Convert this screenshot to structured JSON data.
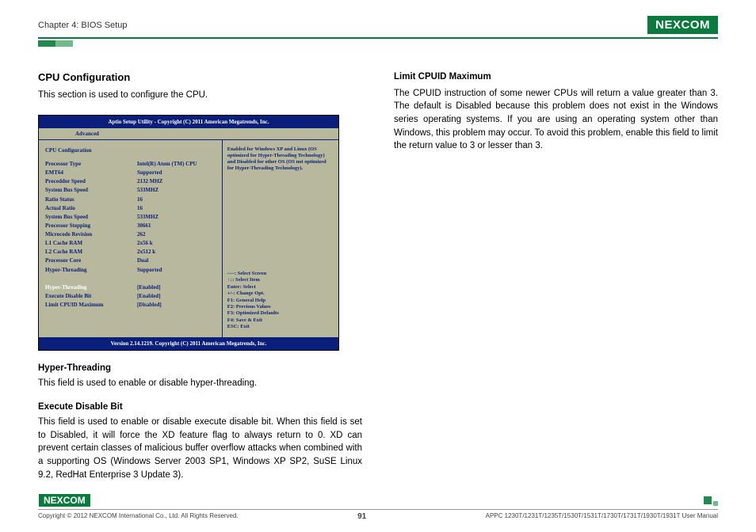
{
  "header": {
    "chapter": "Chapter 4: BIOS Setup",
    "logo": "NE COM",
    "logo_x": "X"
  },
  "left": {
    "title": "CPU Configuration",
    "intro": "This section is used to configure the CPU.",
    "ht_title": "Hyper-Threading",
    "ht_body": "This field is used to enable or disable hyper-threading.",
    "edb_title": "Execute Disable Bit",
    "edb_body": "This field is used to enable or disable execute disable bit. When this field is set to Disabled, it will force the XD feature flag to always return to 0. XD can prevent certain classes of malicious buffer overflow attacks when combined with a supporting OS (Windows Server 2003 SP1, Windows XP SP2, SuSE Linux 9.2, RedHat Enterprise 3 Update 3)."
  },
  "right": {
    "title": "Limit CPUID Maximum",
    "body": "The CPUID instruction of some newer CPUs will return a value greater than 3. The default is Disabled because this problem does not exist in the Windows series operating systems. If you are using an operating system other than Windows, this problem may occur. To avoid this problem, enable this field to limit the return value to 3 or lesser than 3."
  },
  "bios": {
    "title": "Aptio Setup Utility - Copyright (C) 2011 American Megatrends, Inc.",
    "tab": "Advanced",
    "section": "CPU Configuration",
    "rows": [
      {
        "k": "Processor Type",
        "v": "Intel(R) Atom (TM) CPU"
      },
      {
        "k": "EMT64",
        "v": "Supported"
      },
      {
        "k": "Proceddor Speed",
        "v": "2132 MHZ"
      },
      {
        "k": "System Bus Speed",
        "v": "533MHZ"
      },
      {
        "k": "Ratio Status",
        "v": "16"
      },
      {
        "k": "Actual Ratio",
        "v": "16"
      },
      {
        "k": "System Bus Speed",
        "v": "533MHZ"
      },
      {
        "k": "Processor Stepping",
        "v": "30661"
      },
      {
        "k": "Microcode Revision",
        "v": "262"
      },
      {
        "k": "L1 Cache RAM",
        "v": "2x56 k"
      },
      {
        "k": "L2 Cache RAM",
        "v": "2x512 k"
      },
      {
        "k": "Processor Core",
        "v": "Dual"
      },
      {
        "k": "Hyper-Threading",
        "v": "Supported"
      }
    ],
    "opts": [
      {
        "k": "Hyper-Threading",
        "v": "[Enabled]",
        "sel": true
      },
      {
        "k": "Execute Disable Bit",
        "v": "[Enabled]",
        "sel": false
      },
      {
        "k": "Limit CPUID Maximum",
        "v": "[Disabled]",
        "sel": false
      }
    ],
    "help": "Enabled for Windows XP and Linux (OS optimized for Hyper-Threading Technology) and Disabled for other OS (OS not optimized for Hyper-Threading Technology).",
    "keys": [
      "──: Select Screen",
      "↑↓: Select Item",
      "Enter: Select",
      "+/-: Change Opt.",
      "F1: General Help",
      "F2: Previous Values",
      "F3: Optimized Defaults",
      "F4: Save & Exit",
      "ESC: Exit"
    ],
    "footer": "Version 2.14.1219. Copyright (C) 2011 American Megatrends, Inc."
  },
  "footer": {
    "copyright": "Copyright © 2012 NEXCOM International Co., Ltd. All Rights Reserved.",
    "page": "91",
    "doc": "APPC 1230T/1231T/1235T/1530T/1531T/1730T/1731T/1930T/1931T User Manual"
  }
}
